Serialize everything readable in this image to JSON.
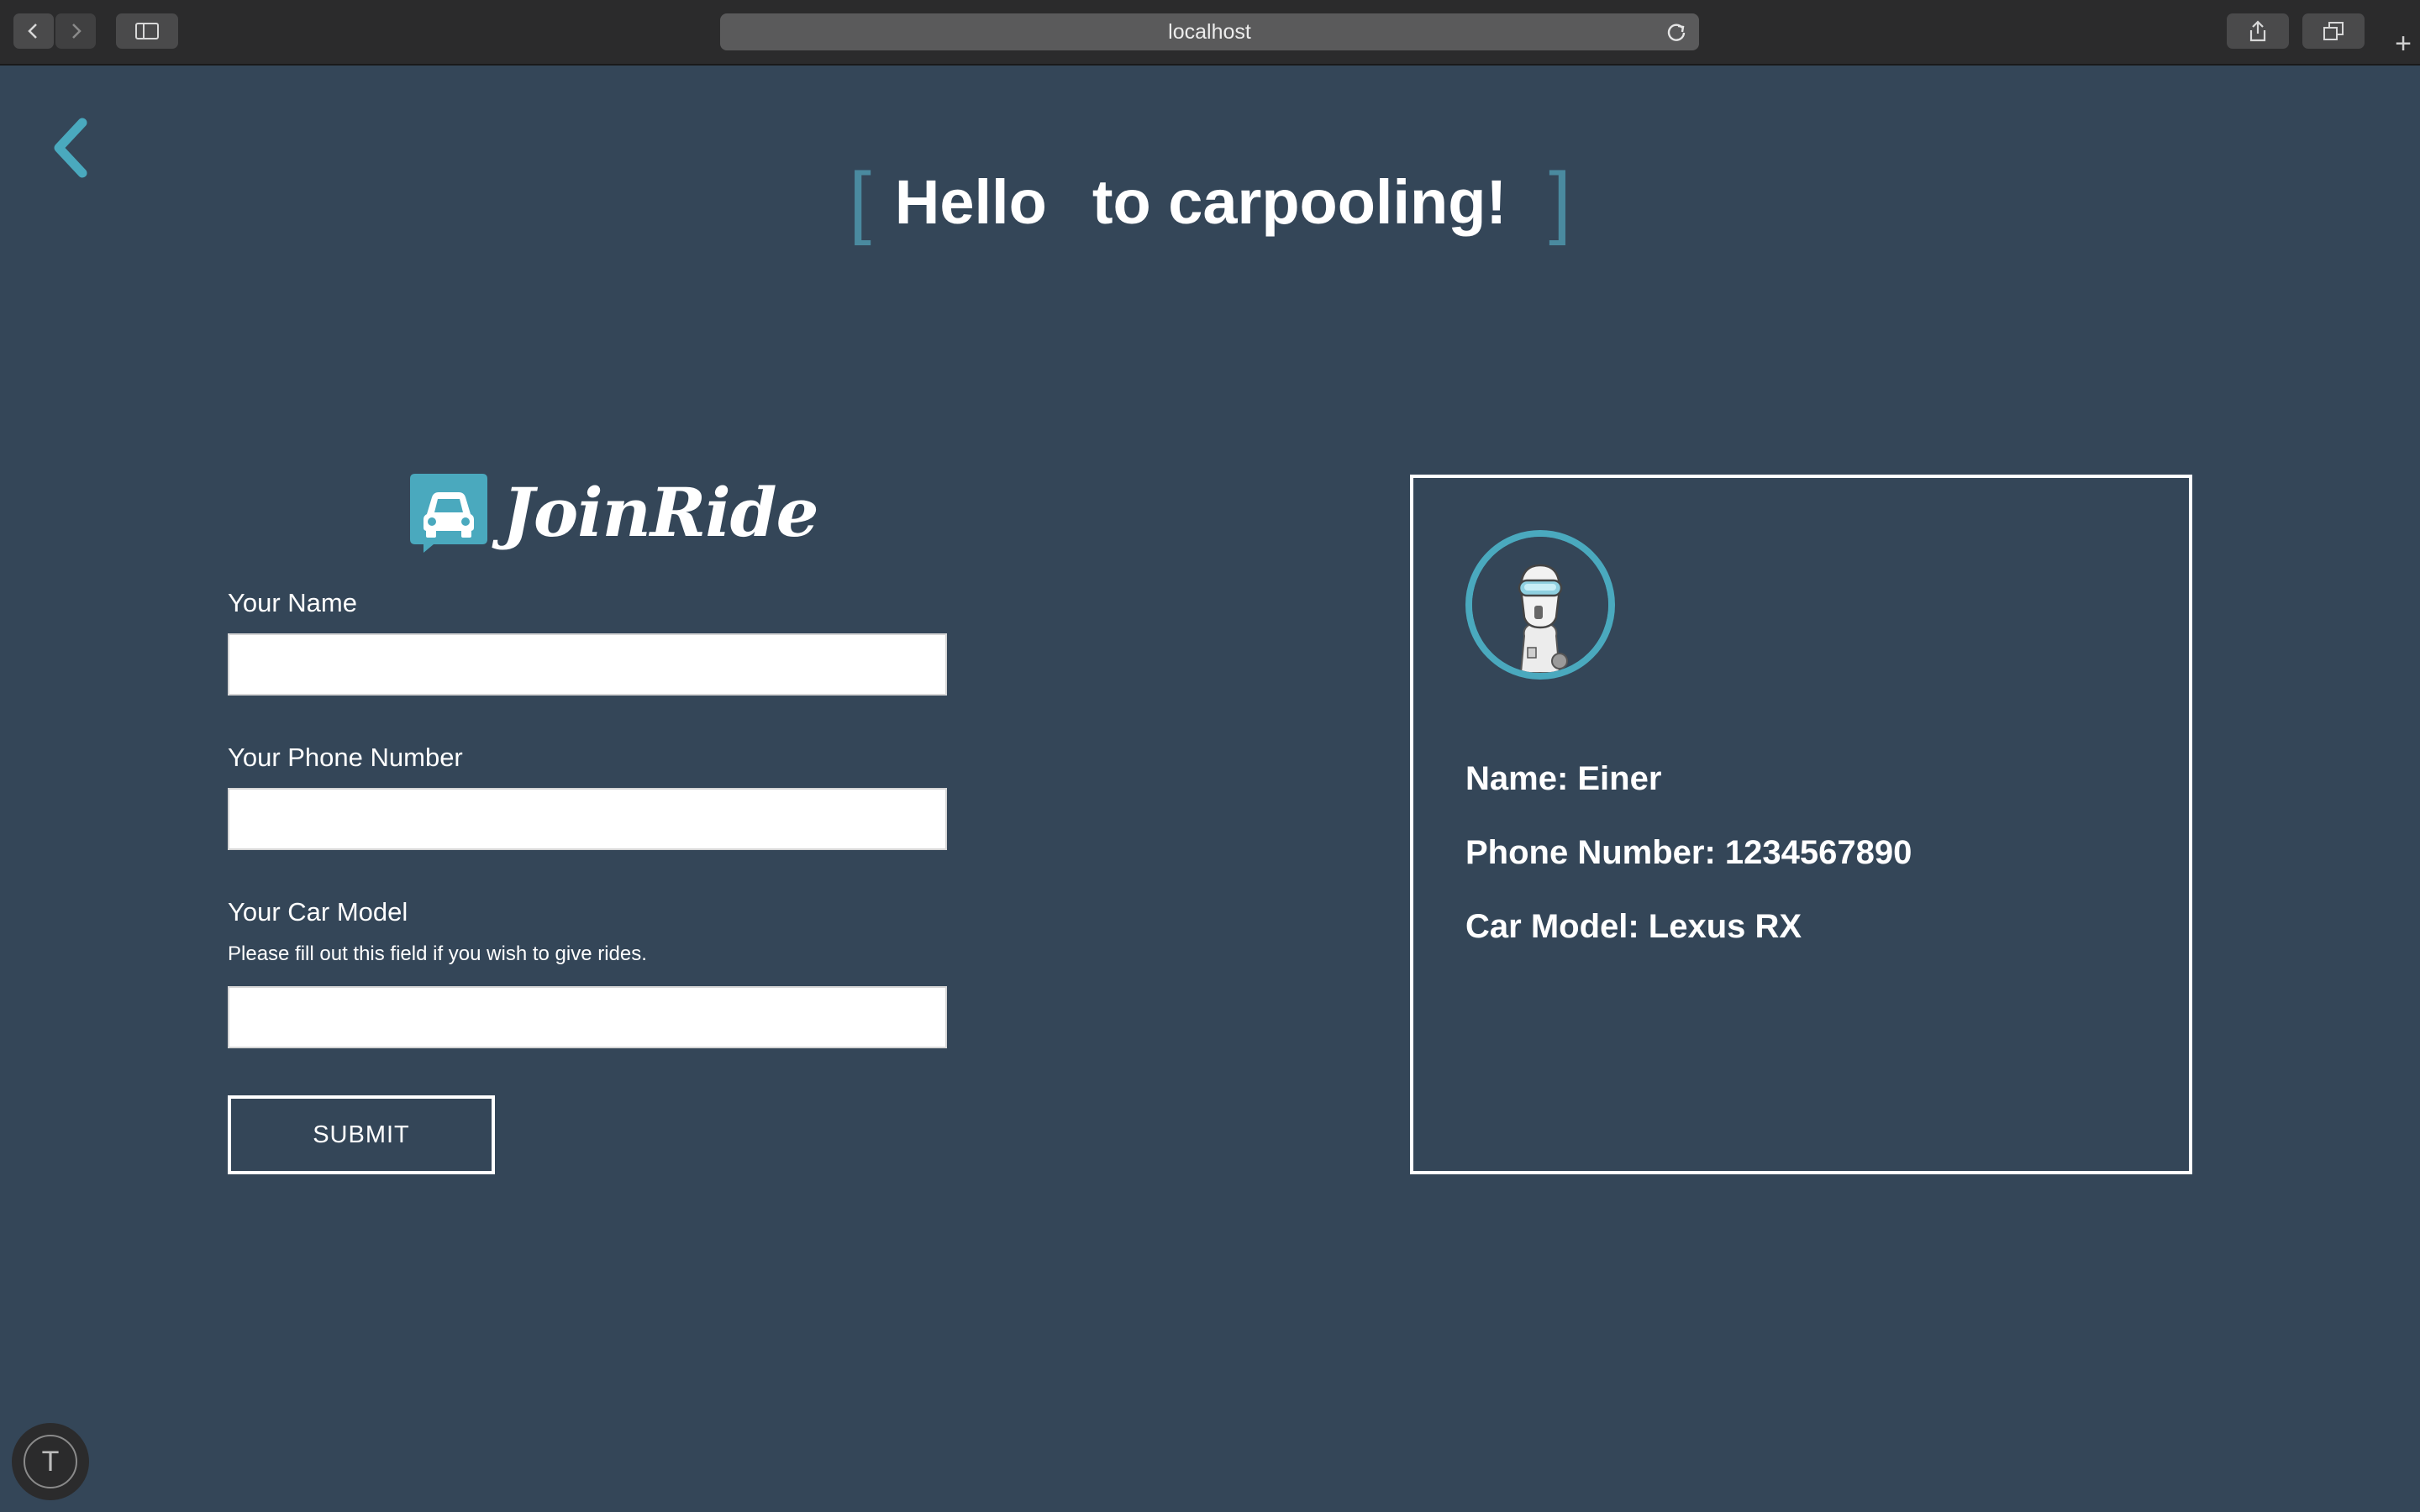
{
  "browser": {
    "url": "localhost",
    "new_tab_label": "+"
  },
  "hero": {
    "left_bracket": "[",
    "word1": "Hello",
    "word2": "to carpooling!",
    "right_bracket": "]"
  },
  "logo": {
    "brand": "JoinRide",
    "icon": "car-chat-icon"
  },
  "form": {
    "name_label": "Your Name",
    "name_value": "",
    "phone_label": "Your Phone Number",
    "phone_value": "",
    "car_label": "Your Car Model",
    "car_hint": "Please fill out this field if you wish to give rides.",
    "car_value": "",
    "submit_label": "SUBMIT"
  },
  "profile": {
    "name_line": "Name: Einer",
    "phone_line": "Phone Number: 1234567890",
    "car_line": "Car Model: Lexus RX",
    "avatar": "robot-avatar"
  },
  "widget": {
    "icon_letter": "T"
  },
  "colors": {
    "background": "#344658",
    "accent": "#4aa9be",
    "bracket": "#4a8a9f"
  }
}
